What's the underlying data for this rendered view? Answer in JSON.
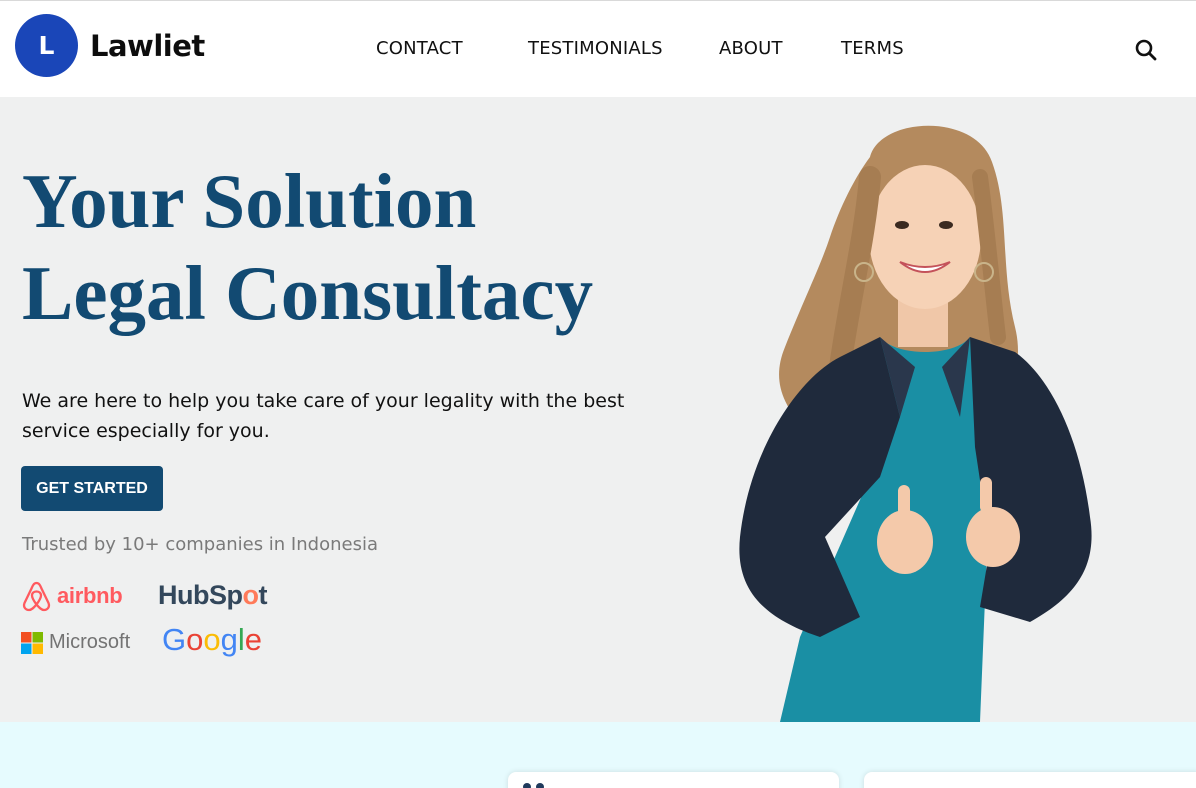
{
  "header": {
    "logo_letter": "L",
    "brand": "Lawliet",
    "nav": [
      "CONTACT",
      "TESTIMONIALS",
      "ABOUT",
      "TERMS"
    ]
  },
  "hero": {
    "headline_line1": "Your Solution",
    "headline_line2": "Legal Consultacy",
    "subcopy": "We are here to help you take care of your legality with the best service especially for you.",
    "cta_label": "GET STARTED",
    "trusted": "Trusted by 10+ companies in Indonesia",
    "companies": [
      "airbnb",
      "HubSpot",
      "Microsoft",
      "Google"
    ]
  },
  "colors": {
    "brand_blue": "#1a46b8",
    "headline": "#124a72",
    "hero_bg": "#eff0f0",
    "bottom_bg": "#e6fbfe"
  }
}
